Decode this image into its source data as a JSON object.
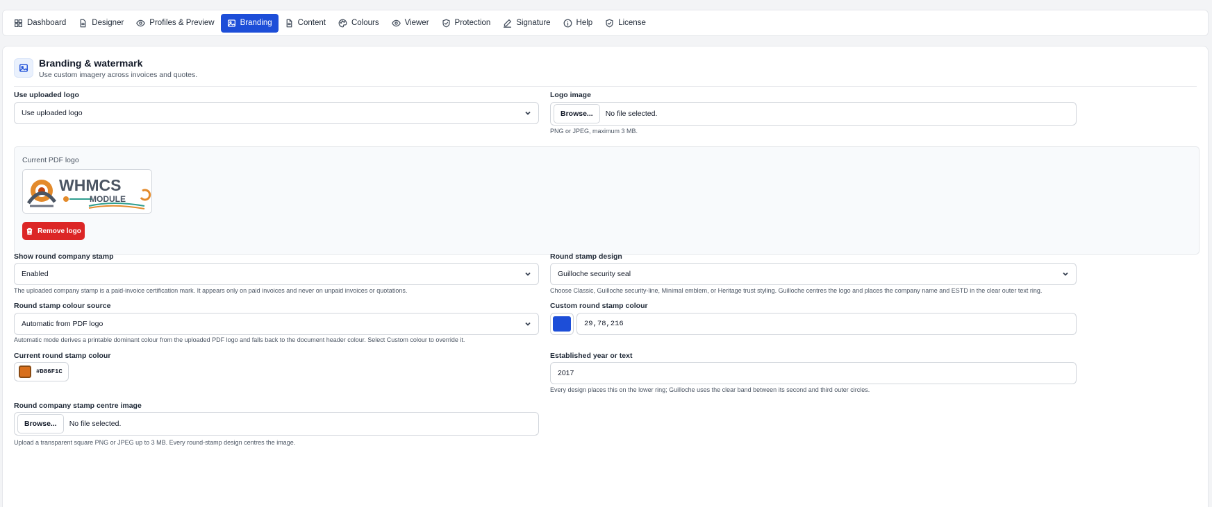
{
  "nav": {
    "tabs": [
      {
        "label": "Dashboard",
        "icon": "grid-icon"
      },
      {
        "label": "Designer",
        "icon": "document-icon"
      },
      {
        "label": "Profiles & Preview",
        "icon": "eye-icon"
      },
      {
        "label": "Branding",
        "icon": "image-icon",
        "active": true
      },
      {
        "label": "Content",
        "icon": "file-text-icon"
      },
      {
        "label": "Colours",
        "icon": "palette-icon"
      },
      {
        "label": "Viewer",
        "icon": "eye-icon"
      },
      {
        "label": "Protection",
        "icon": "shield-check-icon"
      },
      {
        "label": "Signature",
        "icon": "pen-icon"
      },
      {
        "label": "Help",
        "icon": "info-icon"
      },
      {
        "label": "License",
        "icon": "shield-check-icon"
      }
    ]
  },
  "section": {
    "title": "Branding & watermark",
    "subtitle": "Use custom imagery across invoices and quotes.",
    "icon": "image-icon"
  },
  "fields": {
    "use_logo": {
      "label": "Use uploaded logo",
      "value": "Use uploaded logo"
    },
    "logo_image": {
      "label": "Logo image",
      "browse": "Browse...",
      "file": "No file selected.",
      "help": "PNG or JPEG, maximum 3 MB."
    },
    "current_logo": {
      "label": "Current PDF logo",
      "logo_text_top": "WHMCS",
      "logo_text_bottom": "MODULE",
      "remove": "Remove logo"
    },
    "show_stamp": {
      "label": "Show round company stamp",
      "value": "Enabled",
      "help": "The uploaded company stamp is a paid-invoice certification mark. It appears only on paid invoices and never on unpaid invoices or quotations."
    },
    "stamp_design": {
      "label": "Round stamp design",
      "value": "Guilloche security seal",
      "help": "Choose Classic, Guilloche security-line, Minimal emblem, or Heritage trust styling. Guilloche centres the logo and places the company name and ESTD in the clear outer text ring."
    },
    "colour_source": {
      "label": "Round stamp colour source",
      "value": "Automatic from PDF logo",
      "help": "Automatic mode derives a printable dominant colour from the uploaded PDF logo and falls back to the document header colour. Select Custom colour to override it."
    },
    "custom_colour": {
      "label": "Custom round stamp colour",
      "value": "29,78,216",
      "swatch": "#1d4ed8"
    },
    "current_colour": {
      "label": "Current round stamp colour",
      "value": "#D86F1C",
      "swatch": "#d86f1c"
    },
    "established": {
      "label": "Established year or text",
      "value": "2017",
      "help": "Every design places this on the lower ring; Guilloche uses the clear band between its second and third outer circles."
    },
    "centre_image": {
      "label": "Round company stamp centre image",
      "browse": "Browse...",
      "file": "No file selected.",
      "help": "Upload a transparent square PNG or JPEG up to 3 MB. Every round-stamp design centres the image."
    }
  },
  "colors": {
    "accent": "#1d4ed8",
    "danger": "#dc2626"
  }
}
